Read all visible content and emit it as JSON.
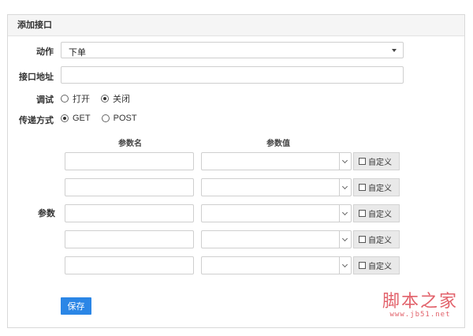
{
  "panel": {
    "title": "添加接口"
  },
  "form": {
    "action_label": "动作",
    "action_value": "下单",
    "url_label": "接口地址",
    "url_value": "",
    "debug_label": "调试",
    "debug_options": [
      "打开",
      "关闭"
    ],
    "debug_selected": "关闭",
    "method_label": "传递方式",
    "method_options": [
      "GET",
      "POST"
    ],
    "method_selected": "GET"
  },
  "params": {
    "label": "参数",
    "name_header": "参数名",
    "value_header": "参数值",
    "custom_label": "自定义",
    "rows": [
      {
        "name": "",
        "value": ""
      },
      {
        "name": "",
        "value": ""
      },
      {
        "name": "",
        "value": ""
      },
      {
        "name": "",
        "value": ""
      },
      {
        "name": "",
        "value": ""
      }
    ]
  },
  "save_label": "保存",
  "watermark": {
    "main": "脚本之家",
    "sub": "www.jb51.net"
  },
  "colors": {
    "primary_button": "#2b86e6",
    "watermark": "#e2626b"
  }
}
